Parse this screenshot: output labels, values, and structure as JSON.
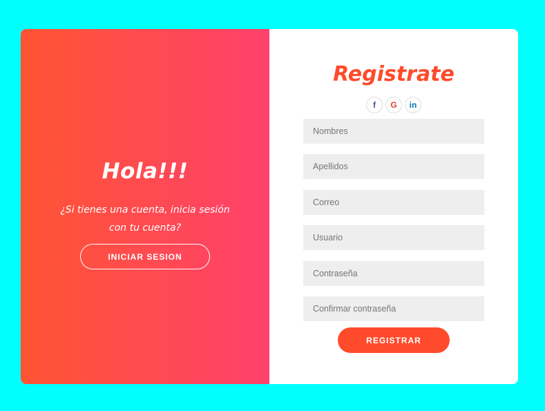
{
  "welcome_panel": {
    "title": "Hola!!!",
    "subtitle": "¿Si tienes una cuenta, inicia sesión con tu cuenta?",
    "login_button": "INICIAR SESION"
  },
  "register_panel": {
    "title": "Registrate",
    "social": [
      {
        "label": "f",
        "icon": "facebook-icon"
      },
      {
        "label": "G",
        "icon": "google-icon"
      },
      {
        "label": "in",
        "icon": "linkedin-icon"
      }
    ],
    "fields": {
      "nombres": {
        "value": "",
        "placeholder": "Nombres"
      },
      "apellidos": {
        "value": "",
        "placeholder": "Apellidos"
      },
      "correo": {
        "value": "",
        "placeholder": "Correo"
      },
      "usuario": {
        "value": "",
        "placeholder": "Usuario"
      },
      "contrasena": {
        "value": "",
        "placeholder": "Contraseña"
      },
      "confirmar": {
        "value": "",
        "placeholder": "Confirmar contraseña"
      }
    },
    "submit_button": "REGISTRAR"
  },
  "colors": {
    "page_background": "#00ffff",
    "gradient_start": "#ff5433",
    "gradient_end": "#ff416c",
    "accent": "#ff4b2b",
    "input_background": "#eeeeee"
  }
}
